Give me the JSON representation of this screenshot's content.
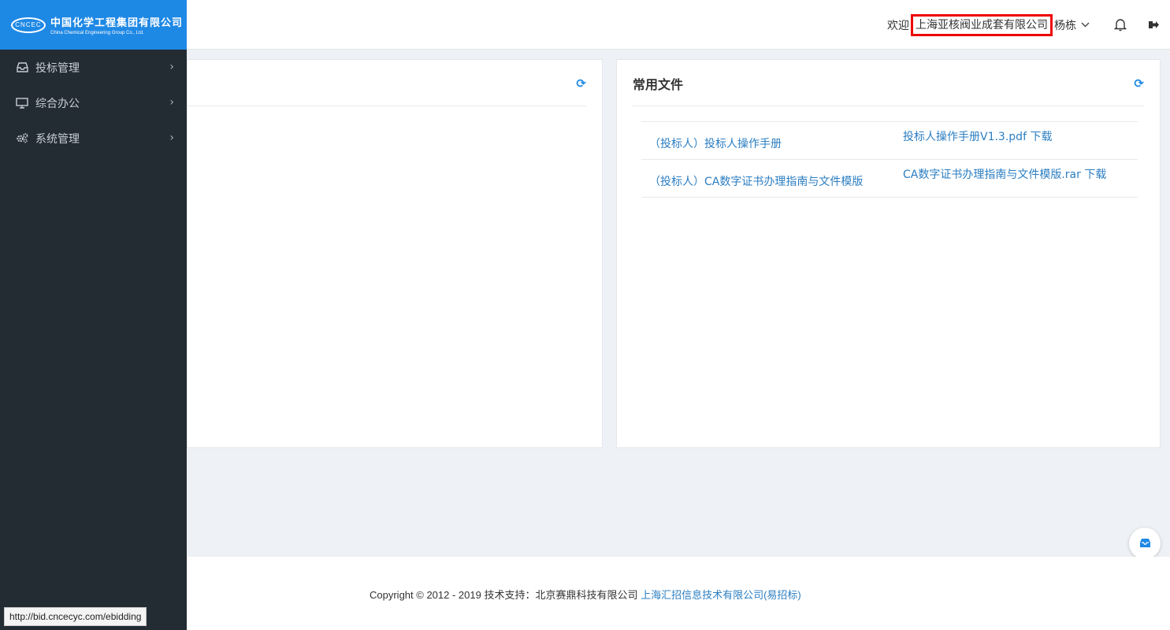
{
  "logo": {
    "mark": "CNCEC",
    "name_cn": "中国化学工程集团有限公司",
    "name_en": "China Chemical Engineering Group Co., Ltd."
  },
  "sidebar": {
    "items": [
      {
        "label": "投标管理",
        "icon": "inbox-icon"
      },
      {
        "label": "综合办公",
        "icon": "monitor-icon"
      },
      {
        "label": "系统管理",
        "icon": "gears-icon"
      }
    ]
  },
  "header": {
    "welcome": "欢迎",
    "company": "上海亚核阀业成套有限公司",
    "user": "杨栋",
    "caret": "﹀"
  },
  "panels": {
    "left": {
      "title": "",
      "refresh": "⟳"
    },
    "right": {
      "title": "常用文件",
      "refresh": "⟳",
      "rows": [
        {
          "name": "（投标人）投标人操作手册",
          "link": "投标人操作手册V1.3.pdf 下载"
        },
        {
          "name": "（投标人）CA数字证书办理指南与文件模版",
          "link": "CA数字证书办理指南与文件模版.rar 下载"
        }
      ]
    }
  },
  "footer": {
    "text": "Copyright © 2012 - 2019 技术支持：北京赛鼎科技有限公司 ",
    "link": "上海汇招信息技术有限公司(易招标)"
  },
  "statusbar": {
    "url": "http://bid.cncecyc.com/ebidding"
  },
  "colors": {
    "primary": "#1e88e5",
    "sidebar": "#232b33",
    "link": "#2b7ec2",
    "highlight": "#e00000"
  }
}
